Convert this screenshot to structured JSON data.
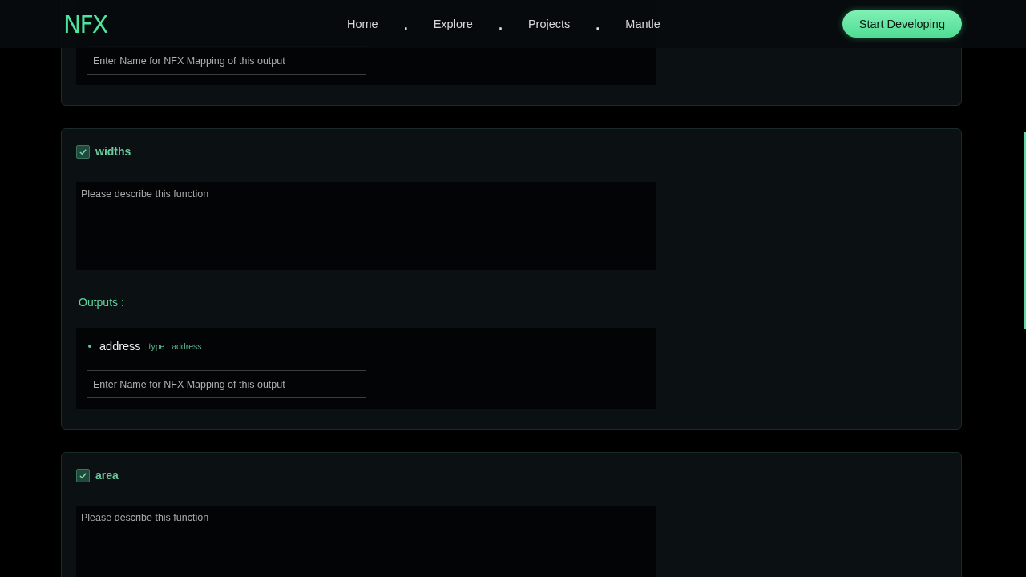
{
  "nav": {
    "logo": "NFX",
    "items": [
      {
        "kind": "link",
        "label": "Home"
      },
      {
        "kind": "dot",
        "label": "."
      },
      {
        "kind": "link",
        "label": "Explore"
      },
      {
        "kind": "dot",
        "label": "."
      },
      {
        "kind": "link",
        "label": "Projects"
      },
      {
        "kind": "dot",
        "label": "."
      },
      {
        "kind": "link",
        "label": "Mantle"
      }
    ],
    "cta": "Start Developing"
  },
  "functions": [
    {
      "outputs": [
        {
          "placeholder": "Enter Name for NFX Mapping of this output"
        }
      ]
    },
    {
      "name": "widths",
      "checked": true,
      "description_placeholder": "Please describe this function",
      "outputs_label": "Outputs :",
      "outputs": [
        {
          "name": "address",
          "type": "type : address",
          "placeholder": "Enter Name for NFX Mapping of this output"
        }
      ]
    },
    {
      "name": "area",
      "checked": true,
      "description_placeholder": "Please describe this function"
    }
  ]
}
